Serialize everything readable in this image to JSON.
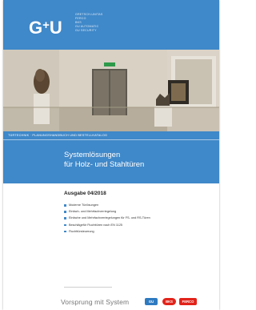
{
  "cover": {
    "logo_g": "G",
    "logo_amp": "+",
    "logo_u": "U",
    "brands": [
      "GRETSCH-UNITAS",
      "FERCO",
      "BKS",
      "GU AUTOMATIC",
      "GU SECURITY"
    ],
    "band_top": "TÜRTECHNIK · PLANUNGSHANDBUCH UND BESTELLKATALOG",
    "title_line1": "Systemlösungen",
    "title_line2": "für Holz- und Stahltüren",
    "edition": "Ausgabe 04/2018",
    "bullets": [
      "Moderne Türlösungen",
      "Einfach- und Mehrfachverriegelung",
      "Einfache und Mehrfachverriegelungen für FS- und RS-Türen",
      "Beschlägefür Fluchttüren nach EN 1125",
      "Fluchttürsteuerung"
    ],
    "slogan": "Vorsprung mit System",
    "badges": [
      "GU",
      "BKS",
      "FERCO"
    ]
  },
  "colors": {
    "accent": "#3f88c9",
    "badge_red": "#e2231a"
  }
}
